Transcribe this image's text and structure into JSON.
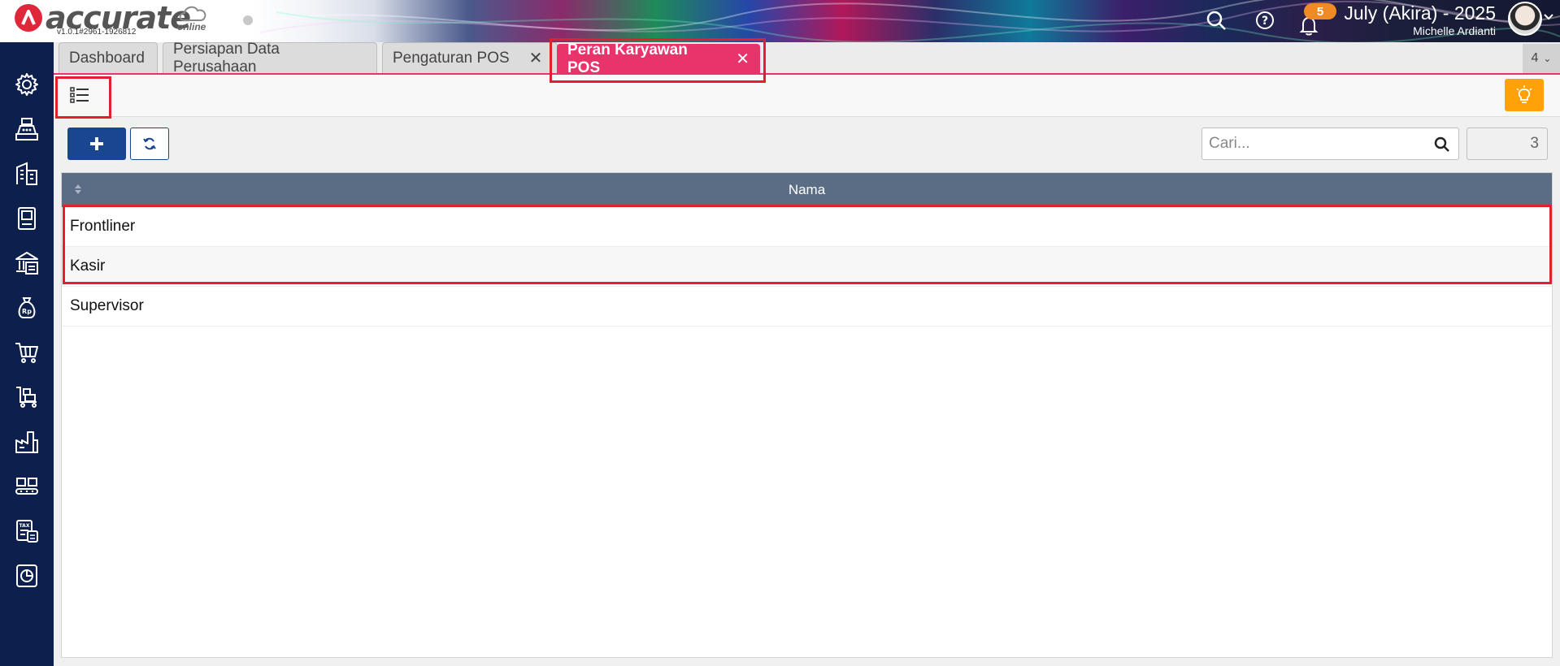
{
  "app": {
    "logo_text": "accurate",
    "logo_sub": "online",
    "version": "v1.0.1#2961-1926812"
  },
  "header": {
    "notification_count": "5",
    "period": "July (Akira) - 2025",
    "user_name": "Michelle Ardianti",
    "icons": [
      "search-icon",
      "help-icon",
      "bell-icon",
      "avatar",
      "chevron-down-icon"
    ]
  },
  "sidebar": {
    "items": [
      {
        "icon": "gear-icon"
      },
      {
        "icon": "cash-register-icon"
      },
      {
        "icon": "building-icon"
      },
      {
        "icon": "book-icon"
      },
      {
        "icon": "bank-icon"
      },
      {
        "icon": "money-bag-icon"
      },
      {
        "icon": "shopping-cart-icon"
      },
      {
        "icon": "sales-cart-icon"
      },
      {
        "icon": "factory-icon"
      },
      {
        "icon": "warehouse-conveyor-icon"
      },
      {
        "icon": "tax-document-icon"
      },
      {
        "icon": "report-chart-icon"
      }
    ]
  },
  "tabs": [
    {
      "label": "Dashboard",
      "closable": false,
      "active": false
    },
    {
      "label": "Persiapan Data Perusahaan",
      "closable": false,
      "active": false
    },
    {
      "label": "Pengaturan POS",
      "closable": true,
      "active": false
    },
    {
      "label": "Peran Karyawan POS",
      "closable": true,
      "active": true
    }
  ],
  "tab_count": "4",
  "toolbar": {
    "list_view_icon": "list-icon",
    "hint_icon": "lightbulb-icon"
  },
  "actions": {
    "add_icon": "plus-icon",
    "refresh_icon": "refresh-icon",
    "search_placeholder": "Cari...",
    "record_count": "3"
  },
  "table": {
    "header": "Nama",
    "rows": [
      "Frontliner",
      "Kasir",
      "Supervisor"
    ]
  },
  "colors": {
    "accent": "#e8336b",
    "sidebar": "#0d1f4c",
    "primary": "#1a4590",
    "table_header": "#5a6d85",
    "hint": "#ffa20a",
    "highlight": "#e0202e",
    "badge": "#f08a24"
  }
}
